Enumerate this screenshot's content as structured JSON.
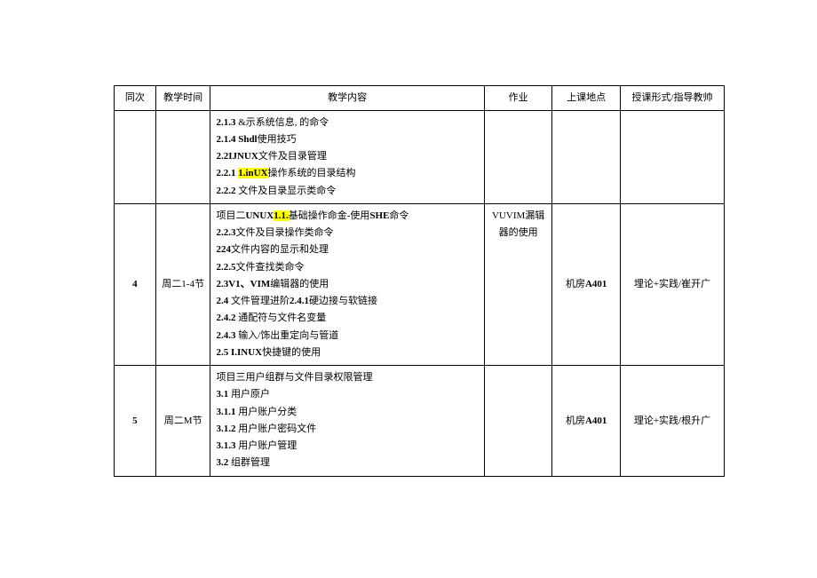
{
  "headers": {
    "idx": "同次",
    "time": "教学时间",
    "content": "教学内容",
    "hw": "作业",
    "loc": "上课地点",
    "form": "授课形式/指导教帅"
  },
  "rows": [
    {
      "idx": "",
      "time": "",
      "content_lines": [
        {
          "pre": "",
          "b": "2.1.3",
          "rest": " &示系统信息, 的命令"
        },
        {
          "pre": "",
          "b": "2.1.4  Shdl",
          "rest": "使用技巧"
        },
        {
          "pre": "",
          "b": "2.2IJNUX",
          "rest": "文件及目录管理"
        },
        {
          "pre": "",
          "b": "2.2.1 ",
          "hl": "1.inUX",
          "rest": "操作系统的目录结构"
        },
        {
          "pre": "",
          "b": "2.2.2",
          "rest": " 文件及目录显示类命令"
        }
      ],
      "hw": "",
      "loc": "",
      "form": ""
    },
    {
      "idx": "4",
      "time": "周二1-4节",
      "content_lines": [
        {
          "pre": "项目二",
          "b": "UNUX",
          "rest": "基础操作命金-使用",
          "b2": "SHE",
          "hl": "1.1.",
          "rest2": "命令"
        },
        {
          "pre": "",
          "b": "2.2.3",
          "rest": "文件及目录操作类命令"
        },
        {
          "pre": "",
          "b": "224",
          "rest": "文件内容的显示和处理"
        },
        {
          "pre": "",
          "b": "2.2.5",
          "rest": "文件查找类命令"
        },
        {
          "pre": "",
          "b": "2.3V1、VIM",
          "rest": "编辑器的使用"
        },
        {
          "pre": "",
          "b": "2.4",
          "rest": "   文件管理进阶",
          "b2": "2.4.1",
          "rest2": "硬边接与软链接"
        },
        {
          "pre": "",
          "b": "2.4.2",
          "rest": " 通配符与文件名变量"
        },
        {
          "pre": "",
          "b": "2.4.3",
          "rest": " 输入/饰出重定向与管道"
        },
        {
          "pre": "",
          "b": "2.5  I.INUX",
          "rest": "快捷键的使用"
        }
      ],
      "hw": "VUVIM漏辑器的使用",
      "loc": "机房A401",
      "form": "埋论+实践/崔开广"
    },
    {
      "idx": "5",
      "time": "周二M节",
      "content_lines": [
        {
          "pre": "项目三用户组群与文件目录权限管理",
          "b": "",
          "rest": ""
        },
        {
          "pre": "",
          "b": "3.1",
          "rest": " 用户原户"
        },
        {
          "pre": "",
          "b": "3.1.1",
          "rest": " 用户账户分类"
        },
        {
          "pre": "",
          "b": "3.1.2",
          "rest": " 用户账户密码文件"
        },
        {
          "pre": "",
          "b": "3.1.3",
          "rest": " 用户账户管理"
        },
        {
          "pre": "",
          "b": "3.2",
          "rest": " 组群管理"
        }
      ],
      "hw": "",
      "loc": "机房A401",
      "form": "理论+实践/根升广"
    }
  ]
}
